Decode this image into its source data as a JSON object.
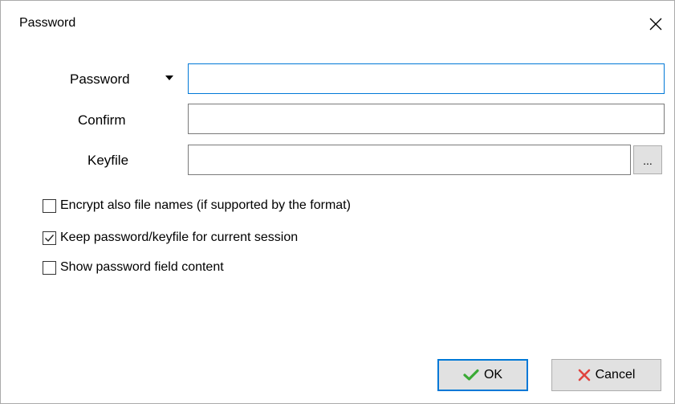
{
  "window": {
    "title": "Password"
  },
  "form": {
    "password_label": "Password",
    "password_value": "",
    "confirm_label": "Confirm",
    "confirm_value": "",
    "keyfile_label": "Keyfile",
    "keyfile_value": "",
    "browse_label": "..."
  },
  "options": [
    {
      "label": "Encrypt also file names (if supported by the format)",
      "checked": false
    },
    {
      "label": "Keep password/keyfile for current session",
      "checked": true
    },
    {
      "label": "Show password field content",
      "checked": false
    }
  ],
  "buttons": {
    "ok_label": "OK",
    "cancel_label": "Cancel"
  },
  "colors": {
    "focus_border": "#0078d7",
    "ok_check": "#3aaa35",
    "cancel_x": "#e0443e"
  },
  "icons": {
    "close": "close-icon",
    "dropdown": "dropdown-arrow-icon",
    "ok": "checkmark-icon",
    "cancel": "x-icon"
  }
}
